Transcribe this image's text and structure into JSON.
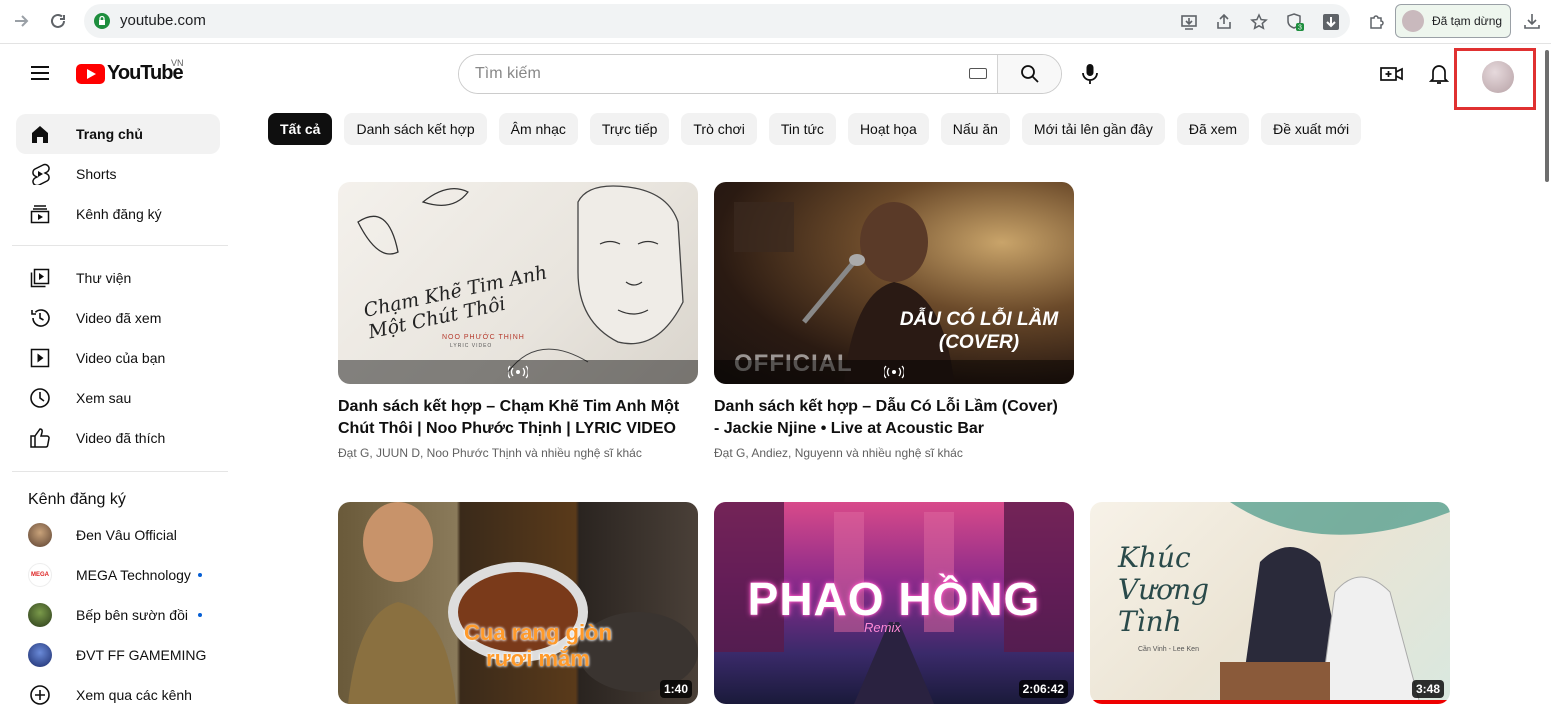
{
  "browser": {
    "url": "youtube.com",
    "paused_label": "Đã tạm dừng",
    "extension_badge": "3"
  },
  "header": {
    "logo_text": "YouTube",
    "country_code": "VN",
    "search_placeholder": "Tìm kiếm"
  },
  "sidebar": {
    "main": [
      {
        "label": "Trang chủ",
        "icon": "home-icon"
      },
      {
        "label": "Shorts",
        "icon": "shorts-icon"
      },
      {
        "label": "Kênh đăng ký",
        "icon": "subscriptions-icon"
      }
    ],
    "library": [
      {
        "label": "Thư viện",
        "icon": "library-icon"
      },
      {
        "label": "Video đã xem",
        "icon": "history-icon"
      },
      {
        "label": "Video của bạn",
        "icon": "your-videos-icon"
      },
      {
        "label": "Xem sau",
        "icon": "watch-later-icon"
      },
      {
        "label": "Video đã thích",
        "icon": "liked-icon"
      }
    ],
    "subscriptions_title": "Kênh đăng ký",
    "subscriptions": [
      {
        "label": "Đen Vâu Official",
        "color": "#8a6a4a",
        "new": false
      },
      {
        "label": "MEGA Technology",
        "color": "#ffffff",
        "new": true
      },
      {
        "label": "Bếp bên sườn đồi",
        "color": "#4a6a2a",
        "new": true
      },
      {
        "label": "ĐVT FF GAMEMING",
        "color": "#3a5aa8",
        "new": false
      },
      {
        "label": "Xem qua các kênh",
        "color": "",
        "new": false
      }
    ]
  },
  "chips": [
    "Tất cả",
    "Danh sách kết hợp",
    "Âm nhạc",
    "Trực tiếp",
    "Trò chơi",
    "Tin tức",
    "Hoạt họa",
    "Nấu ăn",
    "Mới tải lên gần đây",
    "Đã xem",
    "Đề xuất mới"
  ],
  "videos": [
    {
      "title": "Danh sách kết hợp – Chạm Khẽ Tim Anh Một Chút Thôi | Noo Phước Thịnh | LYRIC VIDEO",
      "meta": "Đạt G, JUUN D, Noo Phước Thịnh và nhiều nghệ sĩ khác",
      "thumb_text": "Chạm Khẽ Tim Anh Một Chút Thôi",
      "thumb_sub": "NOO PHƯỚC THỊNH",
      "thumb_sub2": "LYRIC VIDEO"
    },
    {
      "title": "Danh sách kết hợp – Dẫu Có Lỗi Lầm (Cover) - Jackie Njine • Live at Acoustic Bar",
      "meta": "Đạt G, Andiez, Nguyenn và nhiều nghệ sĩ khác",
      "thumb_text": "DẪU CÓ LỖI LẦM",
      "thumb_text2": "(COVER)",
      "thumb_sub": "OFFICIAL"
    },
    {
      "duration": "1:40",
      "thumb_text": "Cua rang giòn",
      "thumb_text2": "rươi mắm"
    },
    {
      "duration": "2:06:42",
      "thumb_text": "PHAO HỒNG",
      "thumb_sub": "Remix"
    },
    {
      "duration": "3:48",
      "thumb_text": "Khúc Vương Tình",
      "thumb_sub": "Cần Vinh - Lee Ken"
    }
  ]
}
